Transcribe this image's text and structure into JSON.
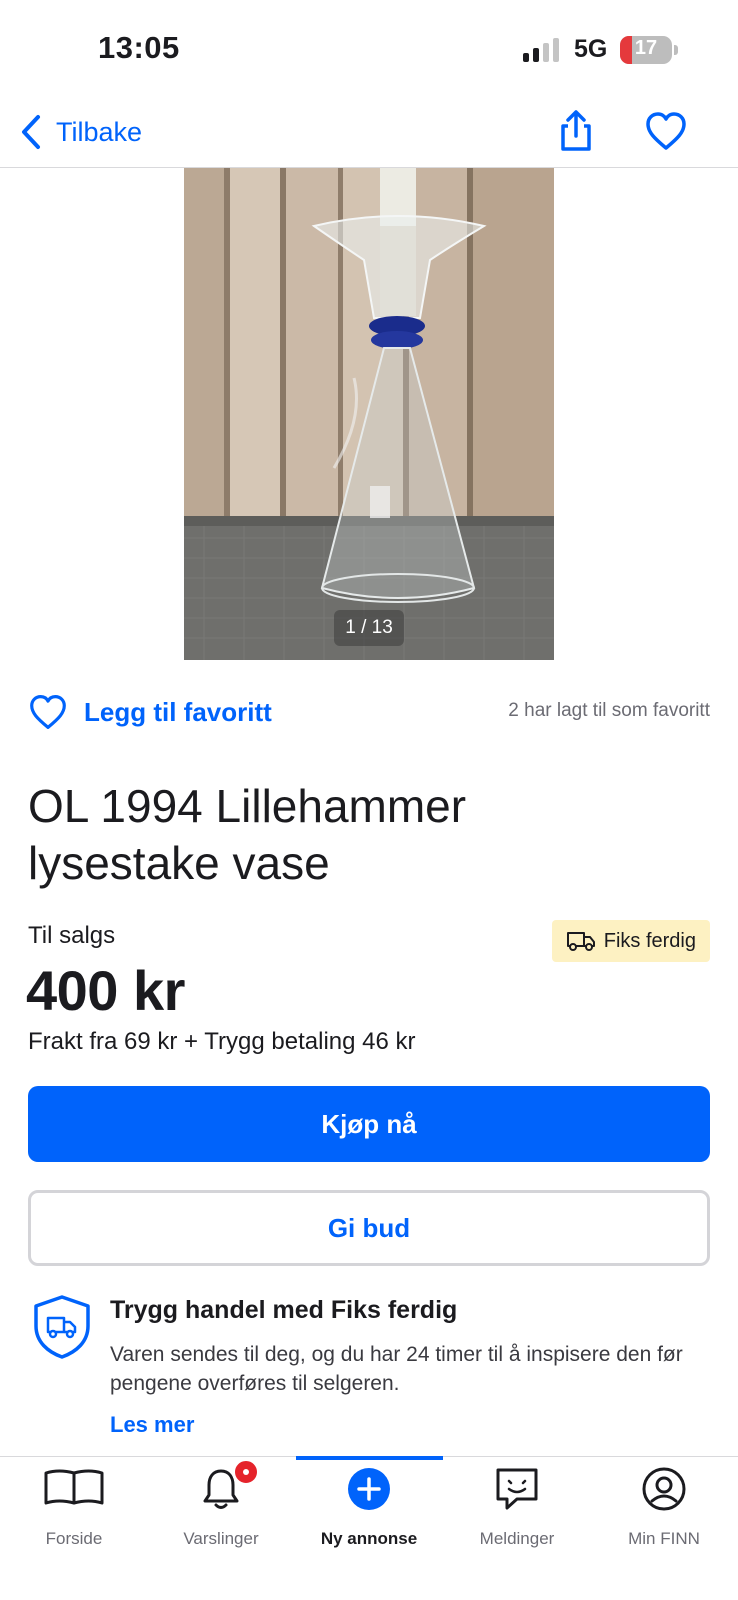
{
  "status_bar": {
    "time": "13:05",
    "network": "5G",
    "battery": "17",
    "battery_level": 0.17,
    "battery_color": "#e5393c"
  },
  "header": {
    "back_label": "Tilbake",
    "back_icon": "chevron-left-icon",
    "share_icon": "share-icon",
    "favorite_icon": "heart-icon"
  },
  "gallery": {
    "counter": "1 / 13",
    "current": 1,
    "total": 13
  },
  "favorite": {
    "label": "Legg til favoritt",
    "count_text": "2 har lagt til som favoritt"
  },
  "listing": {
    "title": "OL 1994 Lillehammer lysestake vase",
    "sale_status": "Til salgs",
    "badge": "Fiks ferdig",
    "price": "400 kr",
    "shipping": "Frakt fra 69 kr + Trygg betaling 46 kr"
  },
  "actions": {
    "buy_now": "Kjøp nå",
    "bid": "Gi bud"
  },
  "info": {
    "title": "Trygg handel med Fiks ferdig",
    "text": "Varen sendes til deg, og du har 24 timer til å inspisere den før pengene overføres til selgeren.",
    "link": "Les mer",
    "icon": "shield-truck-icon"
  },
  "tabbar": {
    "items": [
      {
        "label": "Forside",
        "icon": "book-icon"
      },
      {
        "label": "Varslinger",
        "icon": "bell-icon"
      },
      {
        "label": "Ny annonse",
        "icon": "plus-circle-icon"
      },
      {
        "label": "Meldinger",
        "icon": "chat-icon"
      },
      {
        "label": "Min FINN",
        "icon": "profile-icon"
      }
    ],
    "active": "Ny annonse"
  },
  "colors": {
    "accent": "#0063fb",
    "badge_bg": "#fdf1c2",
    "notification": "#e5232b"
  }
}
